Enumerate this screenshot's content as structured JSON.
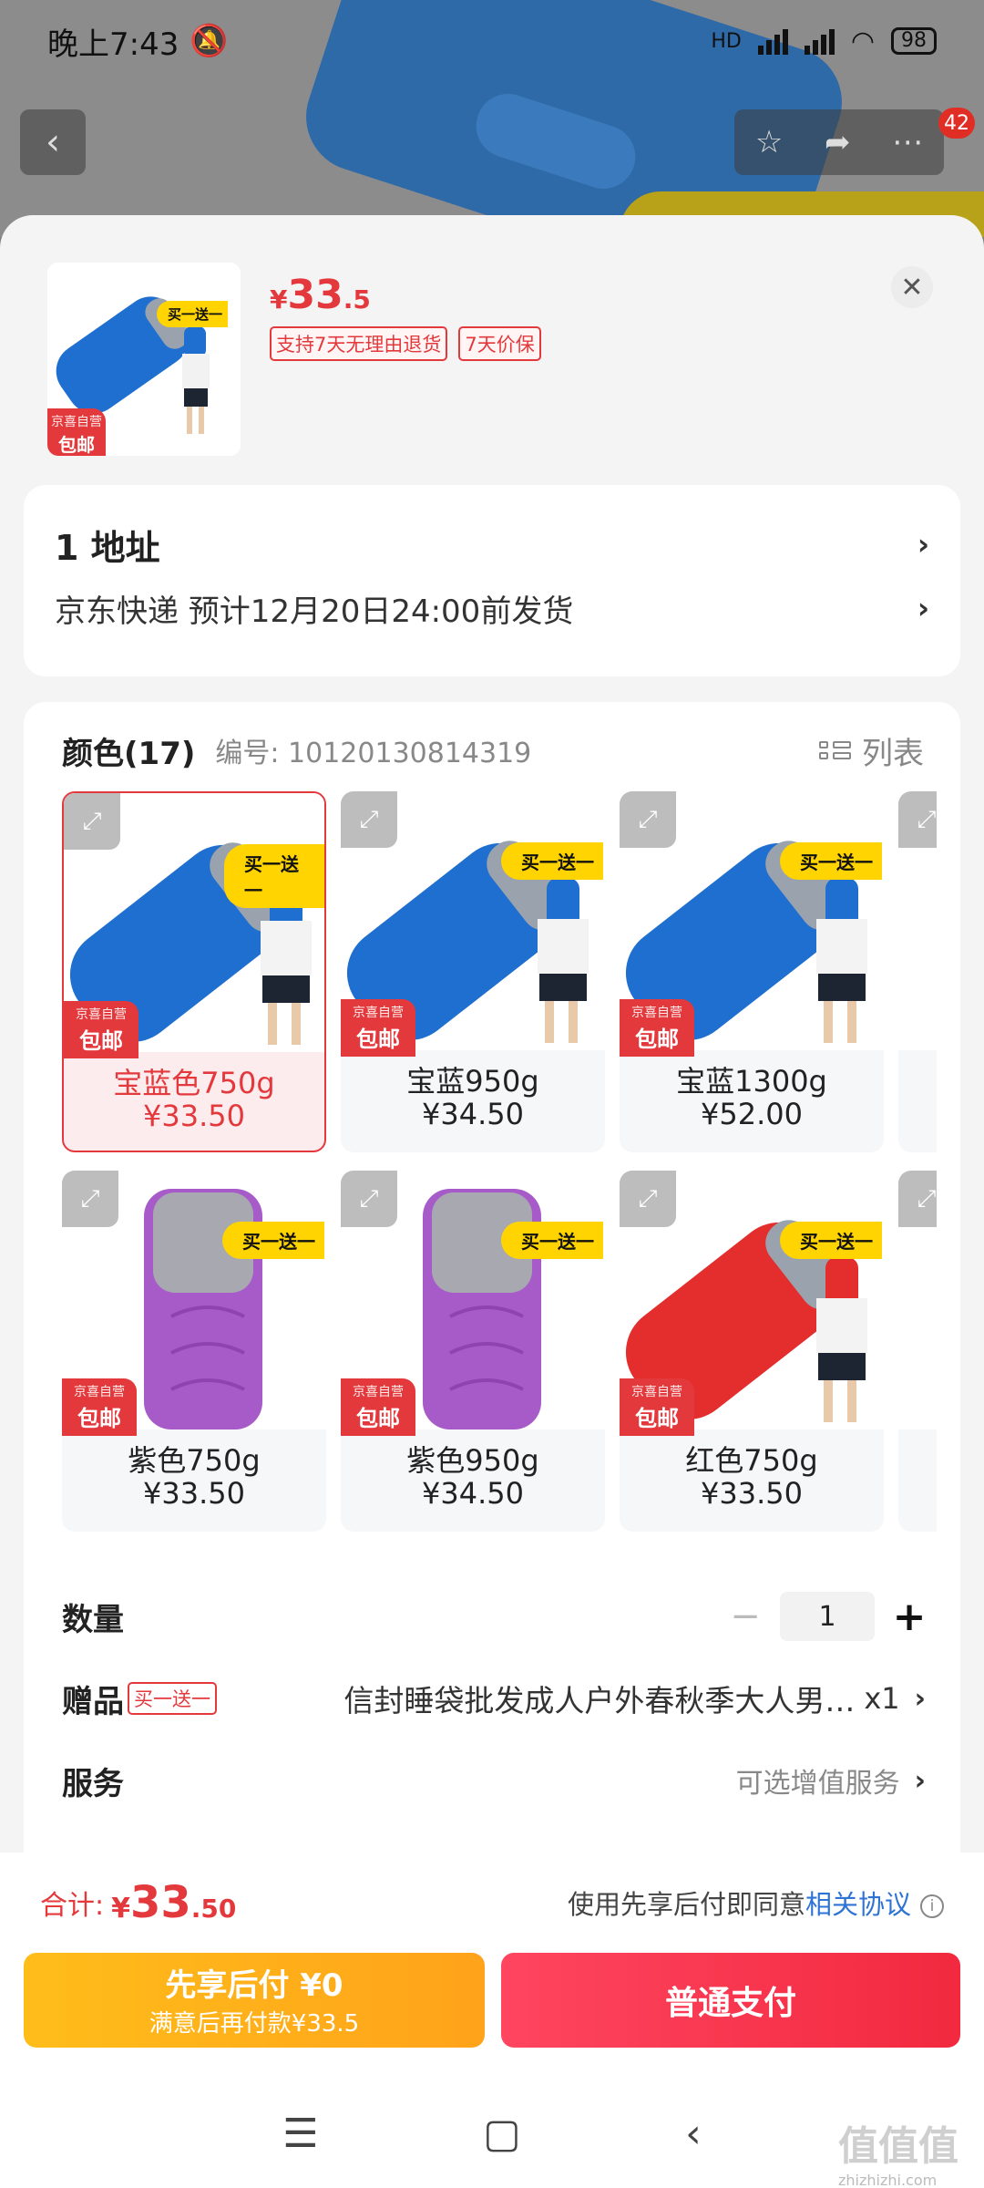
{
  "status_bar": {
    "time": "晚上7:43",
    "battery": "98",
    "network": "HD"
  },
  "nav": {
    "badge_count": "42"
  },
  "product": {
    "price_currency": "¥",
    "price_int": "33",
    "price_dec": ".5",
    "tags": [
      "支持7天无理由退货",
      "7天价保"
    ],
    "thumb_promo": "买一送一",
    "thumb_badge_top": "京喜自营",
    "thumb_badge_main": "包邮"
  },
  "address": {
    "label": "1  地址",
    "shipping": "京东快递 预计12月20日24:00前发货"
  },
  "spec": {
    "title": "颜色(17)",
    "code": "编号: 10120130814319",
    "list_toggle": "列表",
    "promo": "买一送一",
    "badge_top": "京喜自营",
    "badge_main": "包邮",
    "tiles": [
      {
        "name": "宝蓝色750g",
        "price": "¥33.50",
        "color": "#1f6fd0"
      },
      {
        "name": "宝蓝950g",
        "price": "¥34.50",
        "color": "#1f6fd0"
      },
      {
        "name": "宝蓝1300g",
        "price": "¥52.00",
        "color": "#1f6fd0"
      },
      {
        "name": "紫色750g",
        "price": "¥33.50",
        "color": "#a65bc9"
      },
      {
        "name": "紫色950g",
        "price": "¥34.50",
        "color": "#a65bc9"
      },
      {
        "name": "红色750g",
        "price": "¥33.50",
        "color": "#e42d2d"
      }
    ]
  },
  "quantity": {
    "label": "数量",
    "value": "1",
    "minus": "−",
    "plus": "+"
  },
  "gift": {
    "label": "赠品",
    "tag": "买一送一",
    "name": "信封睡袋批发成人户外春秋季大人男…",
    "qty": "x1"
  },
  "service": {
    "label": "服务",
    "note": "可选增值服务"
  },
  "paybar": {
    "total_label": "合计:",
    "total_currency": "¥",
    "total_int": "33",
    "total_dec": ".50",
    "agree_text": "使用先享后付即同意",
    "agree_link": "相关协议",
    "later_line1": "先享后付 ¥0",
    "later_line2": "满意后再付款¥33.5",
    "pay_label": "普通支付"
  },
  "watermark": {
    "main": "值值值",
    "sub": "zhizhizhi.com"
  },
  "colors": {
    "accent": "#e4393c",
    "link": "#2f74d4",
    "later_btn": "#ffb31a",
    "pay_btn": "#f5324b"
  }
}
